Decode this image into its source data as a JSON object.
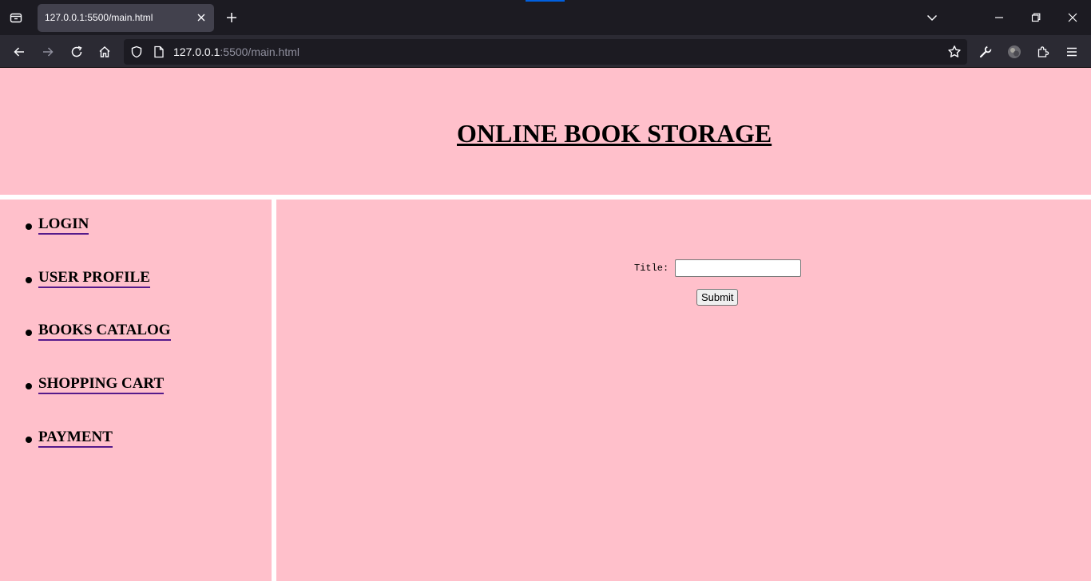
{
  "browser": {
    "tab_title": "127.0.0.1:5500/main.html",
    "url_host": "127.0.0.1",
    "url_rest": ":5500/main.html",
    "icons": [
      "tab-list-icon",
      "close-icon",
      "plus-icon",
      "chevron-down-icon",
      "minimize-icon",
      "restore-icon",
      "window-close-icon",
      "back-arrow-icon",
      "forward-arrow-icon",
      "reload-icon",
      "home-icon",
      "shield-icon",
      "page-icon",
      "star-icon",
      "wrench-icon",
      "account-icon",
      "extensions-icon",
      "menu-icon"
    ]
  },
  "page": {
    "title": "ONLINE BOOK STORAGE",
    "nav": [
      {
        "label": "LOGIN"
      },
      {
        "label": "USER PROFILE"
      },
      {
        "label": "BOOKS CATALOG"
      },
      {
        "label": "SHOPPING CART"
      },
      {
        "label": "PAYMENT"
      }
    ],
    "form": {
      "title_label": "Title:",
      "title_value": "",
      "submit_label": "Submit"
    }
  },
  "colors": {
    "page_background": "#ffc0cb",
    "divider": "#ffffff",
    "link_underline": "#551a8b",
    "chrome_tabbar": "#1c1b22",
    "chrome_toolbar": "#2b2a33"
  }
}
